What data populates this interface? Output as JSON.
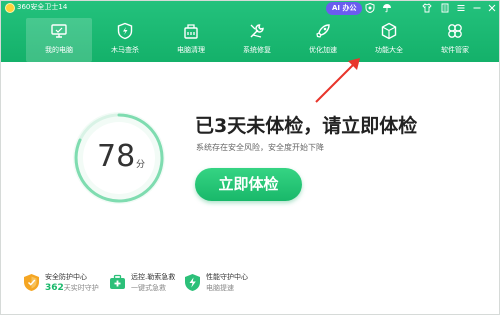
{
  "window": {
    "title": "360安全卫士14"
  },
  "titlebar": {
    "ai_label": "AI 办公",
    "icons": [
      "shield-check-icon",
      "umbrella-icon",
      "shirt-icon",
      "settings-icon",
      "menu-icon",
      "minimize-icon",
      "close-icon"
    ]
  },
  "nav": {
    "items": [
      {
        "label": "我的电脑",
        "icon": "monitor-icon",
        "active": true
      },
      {
        "label": "木马查杀",
        "icon": "shield-lightning-icon",
        "active": false
      },
      {
        "label": "电脑清理",
        "icon": "broom-icon",
        "active": false
      },
      {
        "label": "系统修复",
        "icon": "wrench-icon",
        "active": false
      },
      {
        "label": "优化加速",
        "icon": "rocket-icon",
        "active": false
      },
      {
        "label": "功能大全",
        "icon": "cube-icon",
        "active": false
      },
      {
        "label": "软件管家",
        "icon": "clover-icon",
        "active": false
      }
    ]
  },
  "main": {
    "score": "78",
    "score_unit": "分",
    "headline": "已3天未体检，请立即体检",
    "subline": "系统存在安全风险，安全度开始下降",
    "checkup_button": "立即体检"
  },
  "features": [
    {
      "title": "安全防护中心",
      "sub_num": "362",
      "sub": "天实时守护",
      "icon": "shield-orange-icon"
    },
    {
      "title": "远控.勒索急救",
      "sub_num": "",
      "sub": "一键式急救",
      "icon": "rescue-kit-icon"
    },
    {
      "title": "性能守护中心",
      "sub_num": "",
      "sub": "电脑提速",
      "icon": "performance-shield-icon"
    }
  ],
  "colors": {
    "brand_green": "#19b86a",
    "header_green": "#1cb872",
    "ai_purple": "#6b5cf0",
    "arrow_red": "#e8352b"
  }
}
